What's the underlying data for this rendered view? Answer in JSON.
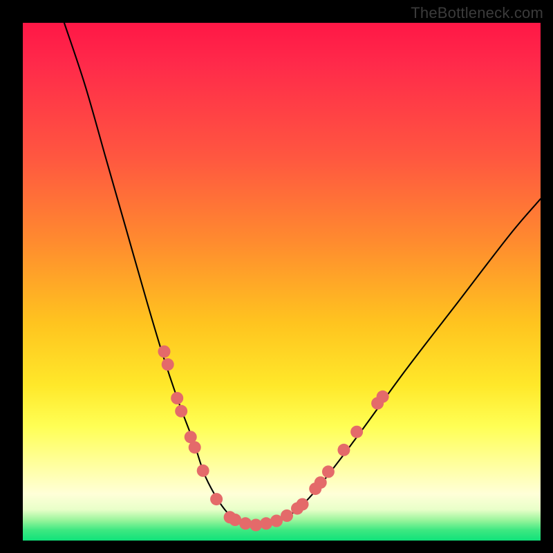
{
  "watermark": "TheBottleneck.com",
  "chart_data": {
    "type": "line",
    "title": "",
    "xlabel": "",
    "ylabel": "",
    "xlim": [
      0,
      100
    ],
    "ylim": [
      0,
      100
    ],
    "grid": false,
    "legend": false,
    "series": [
      {
        "name": "bottleneck-curve",
        "color": "#000000",
        "x": [
          8,
          12,
          16,
          20,
          24,
          27,
          30,
          33,
          35,
          37,
          39,
          41,
          43,
          45,
          47,
          50,
          53,
          56,
          60,
          66,
          74,
          84,
          94,
          100
        ],
        "y": [
          100,
          88,
          74,
          60,
          46,
          36,
          27,
          19,
          13,
          9,
          6,
          4,
          3,
          3,
          3,
          4,
          6,
          9,
          14,
          22,
          33,
          46,
          59,
          66
        ]
      }
    ],
    "markers": {
      "name": "highlight-dots",
      "color": "#e46a6a",
      "radius_pct": 1.2,
      "points": [
        {
          "x": 27.3,
          "y": 36.5
        },
        {
          "x": 28.0,
          "y": 34.0
        },
        {
          "x": 29.8,
          "y": 27.5
        },
        {
          "x": 30.6,
          "y": 25.0
        },
        {
          "x": 32.4,
          "y": 20.0
        },
        {
          "x": 33.2,
          "y": 18.0
        },
        {
          "x": 34.8,
          "y": 13.5
        },
        {
          "x": 37.4,
          "y": 8.0
        },
        {
          "x": 40.0,
          "y": 4.5
        },
        {
          "x": 41.0,
          "y": 4.0
        },
        {
          "x": 43.0,
          "y": 3.3
        },
        {
          "x": 45.0,
          "y": 3.0
        },
        {
          "x": 47.0,
          "y": 3.3
        },
        {
          "x": 49.0,
          "y": 3.8
        },
        {
          "x": 51.0,
          "y": 4.8
        },
        {
          "x": 53.0,
          "y": 6.2
        },
        {
          "x": 54.0,
          "y": 7.0
        },
        {
          "x": 56.5,
          "y": 10.0
        },
        {
          "x": 57.5,
          "y": 11.2
        },
        {
          "x": 59.0,
          "y": 13.3
        },
        {
          "x": 62.0,
          "y": 17.5
        },
        {
          "x": 64.5,
          "y": 21.0
        },
        {
          "x": 68.5,
          "y": 26.5
        },
        {
          "x": 69.5,
          "y": 27.8
        }
      ]
    }
  }
}
